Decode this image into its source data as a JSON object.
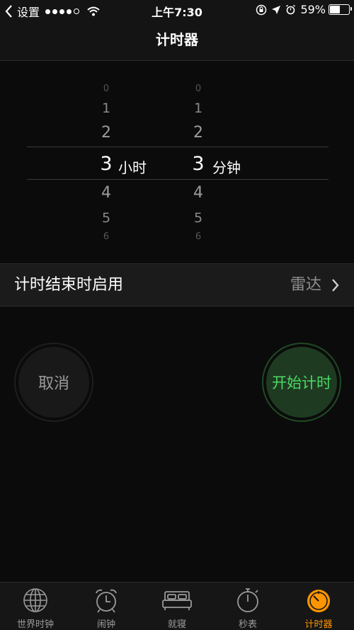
{
  "status_bar": {
    "back_app": "设置",
    "time": "上午7:30",
    "battery": "59%",
    "battery_level": 0.59,
    "signal_dots_filled": 4
  },
  "nav": {
    "title": "计时器"
  },
  "picker": {
    "hours": {
      "above": [
        "0",
        "1",
        "2"
      ],
      "selected": "3",
      "below": [
        "4",
        "5",
        "6"
      ],
      "unit": "小时"
    },
    "minutes": {
      "above": [
        "0",
        "1",
        "2"
      ],
      "selected": "3",
      "below": [
        "4",
        "5",
        "6"
      ],
      "unit": "分钟"
    }
  },
  "end_action": {
    "label": "计时结束时启用",
    "value": "雷达"
  },
  "buttons": {
    "cancel": "取消",
    "start": "开始计时"
  },
  "tabbar": {
    "items": [
      {
        "label": "世界时钟",
        "icon": "globe-icon"
      },
      {
        "label": "闹钟",
        "icon": "alarm-clock-icon"
      },
      {
        "label": "就寝",
        "icon": "bed-icon"
      },
      {
        "label": "秒表",
        "icon": "stopwatch-icon"
      },
      {
        "label": "计时器",
        "icon": "timer-icon",
        "active": true
      }
    ]
  },
  "colors": {
    "accent": "#ff9500",
    "start_green": "#4cd964"
  }
}
